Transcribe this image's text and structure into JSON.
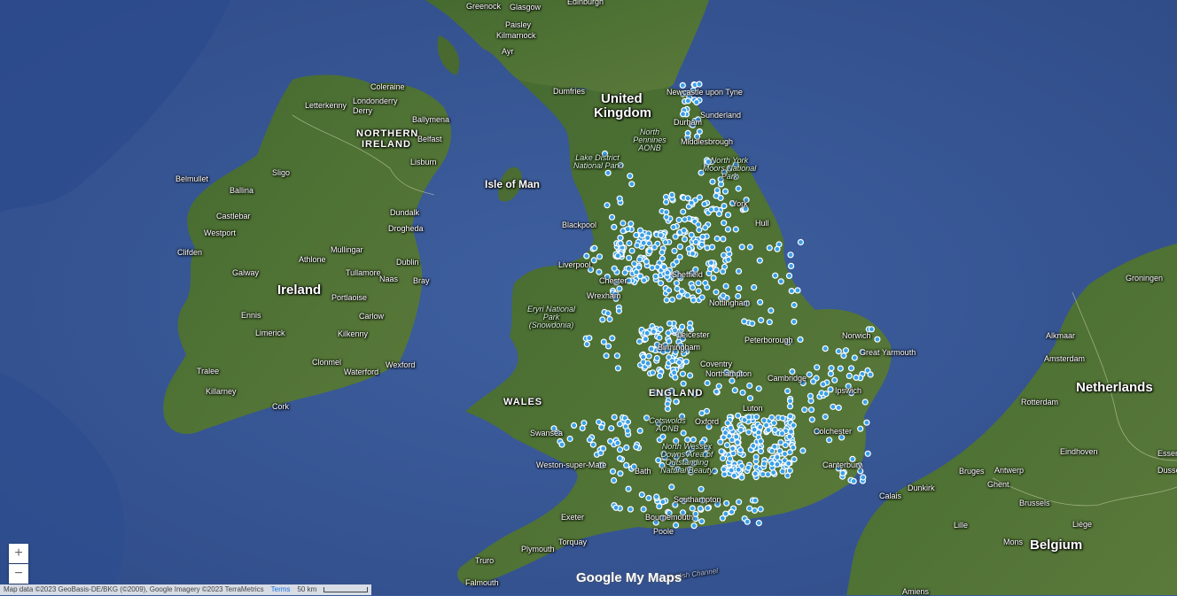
{
  "labels": {
    "countries": [
      "United",
      "Kingdom",
      "Ireland",
      "Netherlands",
      "Belgium"
    ],
    "regions": [
      "NORTHERN",
      "IRELAND",
      "WALES",
      "ENGLAND"
    ],
    "islands": [
      "Isle of Man"
    ],
    "parks": [
      "North Pennines AONB",
      "Lake District National Park",
      "North York Moors National Park",
      "Eryri National Park (Snowdonia)",
      "Cotswolds AONB",
      "North Wessex Downs Area of Outstanding Natural Beauty"
    ],
    "seas": [
      "English Channel"
    ],
    "cities": [
      "Greenock",
      "Glasgow",
      "Edinburgh",
      "Paisley",
      "Kilmarnock",
      "Ayr",
      "Dumfries",
      "Newcastle upon Tyne",
      "Sunderland",
      "Durham",
      "Middlesbrough",
      "York",
      "Hull",
      "Coleraine",
      "Londonderry",
      "Derry",
      "Letterkenny",
      "Ballymena",
      "Belfast",
      "Lisburn",
      "Sligo",
      "Belmullet",
      "Ballina",
      "Castlebar",
      "Westport",
      "Clifden",
      "Dundalk",
      "Drogheda",
      "Athlone",
      "Mullingar",
      "Dublin",
      "Galway",
      "Tullamore",
      "Naas",
      "Bray",
      "Portlaoise",
      "Ennis",
      "Carlow",
      "Limerick",
      "Kilkenny",
      "Clonmel",
      "Tralee",
      "Waterford",
      "Wexford",
      "Killarney",
      "Cork",
      "Blackpool",
      "Liverpool",
      "Chester",
      "Wrexham",
      "Sheffield",
      "Nottingham",
      "Leicester",
      "Coventry",
      "Birmingham",
      "Peterborough",
      "Norwich",
      "Great Yarmouth",
      "Northampton",
      "Cambridge",
      "Ipswich",
      "Colchester",
      "Oxford",
      "Luton",
      "Swansea",
      "Bath",
      "Weston-super-Mare",
      "Southampton",
      "Bournemouth",
      "Poole",
      "Exeter",
      "Torquay",
      "Plymouth",
      "Truro",
      "Falmouth",
      "Canterbury",
      "Alkmaar",
      "Amsterdam",
      "Rotterdam",
      "Eindhoven",
      "Antwerp",
      "Bruges",
      "Ghent",
      "Brussels",
      "Dunkirk",
      "Calais",
      "Lille",
      "Mons",
      "Liège",
      "Groningen",
      "Essen",
      "Dusseldorf",
      "Amiens"
    ]
  },
  "controls": {
    "zoom_in": "+",
    "zoom_out": "−"
  },
  "footer": {
    "attribution": "Map data ©2023 GeoBasis-DE/BKG (©2009), Google Imagery ©2023 TerraMetrics",
    "terms": "Terms",
    "scale": "50 km"
  },
  "logo": "Google My Maps",
  "colors": {
    "sea": "#3b5a9a",
    "land": "#4d6b34",
    "marker": "#3aa0e8",
    "marker_border": "#ffffff"
  },
  "markers": {
    "description": "Clustered blue location pins across England"
  }
}
